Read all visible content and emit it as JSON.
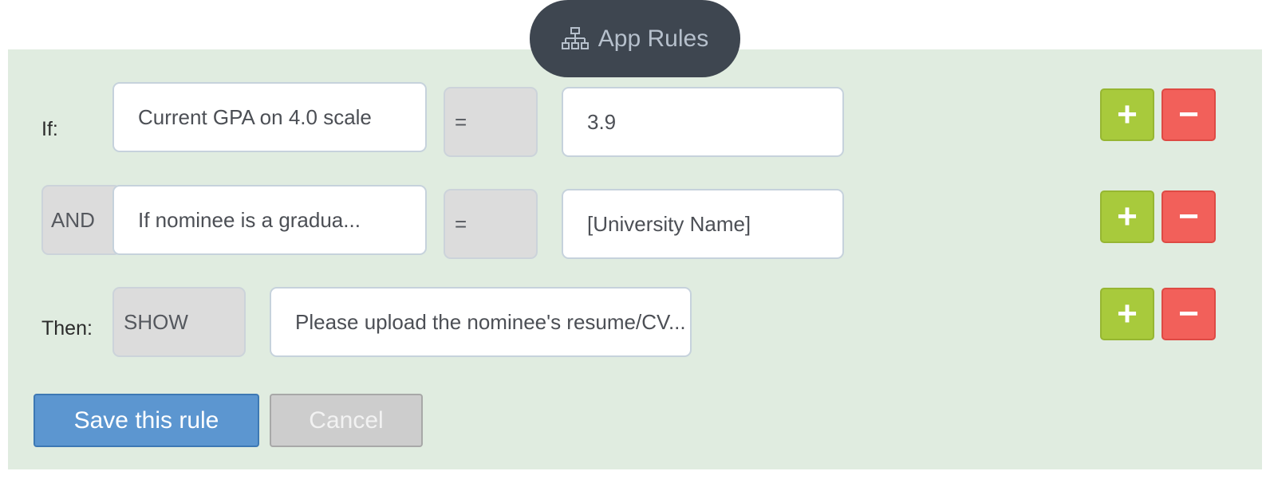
{
  "tab": {
    "icon": "sitemap-icon",
    "label": "App Rules"
  },
  "rules": {
    "if_label": "If:",
    "condition1": {
      "field": "Current GPA on 4.0 scale",
      "operator": "=",
      "value": "3.9"
    },
    "condition2": {
      "connector": "AND",
      "field": "If nominee is a gradua...",
      "operator": "=",
      "value": "[University Name]"
    },
    "then_label": "Then:",
    "action": {
      "verb": "SHOW",
      "target": "Please upload the nominee's resume/CV..."
    }
  },
  "row_buttons": {
    "add_symbol": "+",
    "remove_symbol": "−"
  },
  "footer": {
    "save_label": "Save this rule",
    "cancel_label": "Cancel"
  },
  "colors": {
    "panel_bg": "#e0ece0",
    "tab_bg": "#3e4650",
    "add_green": "#a8ca3c",
    "remove_red": "#f2605a",
    "save_blue": "#5c96d0"
  }
}
